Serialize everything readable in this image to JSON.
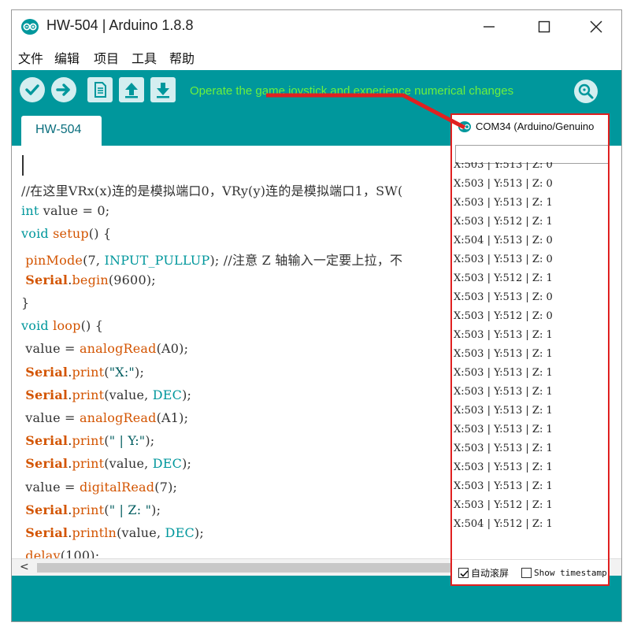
{
  "window": {
    "title": "HW-504 | Arduino 1.8.8"
  },
  "menu": {
    "items": [
      "文件",
      "编辑",
      "项目",
      "工具",
      "帮助"
    ]
  },
  "toolbar": {
    "annotation": "Operate the game joystick and experience numerical changes",
    "buttons": [
      "verify-icon",
      "upload-icon",
      "new-icon",
      "open-icon",
      "save-icon"
    ],
    "monitor_icon": "serial-monitor-icon"
  },
  "tabs": [
    {
      "label": "HW-504"
    }
  ],
  "editor": {
    "lines": [
      "//在这里VRx(x)连的是模拟端口0，VRy(y)连的是模拟端口1，SW(",
      "int value = 0;",
      "void setup() {",
      " pinMode(7, INPUT_PULLUP); //注意 Z 轴输入一定要上拉，不",
      " Serial.begin(9600);",
      "}",
      "void loop() {",
      " value = analogRead(A0);",
      " Serial.print(\"X:\");",
      " Serial.print(value, DEC);",
      " value = analogRead(A1);",
      " Serial.print(\" | Y:\");",
      " Serial.print(value, DEC);",
      " value = digitalRead(7);",
      " Serial.print(\" | Z: \");",
      " Serial.println(value, DEC);",
      " delay(100);"
    ]
  },
  "serial_monitor": {
    "title": "COM34 (Arduino/Genuino",
    "input_value": "",
    "lines": [
      "X:503 | Y:513 | Z: 0",
      "X:503 | Y:513 | Z: 0",
      "X:503 | Y:513 | Z: 1",
      "X:503 | Y:512 | Z: 1",
      "X:504 | Y:513 | Z: 0",
      "X:503 | Y:513 | Z: 0",
      "X:503 | Y:512 | Z: 1",
      "X:503 | Y:513 | Z: 0",
      "X:503 | Y:512 | Z: 0",
      "X:503 | Y:513 | Z: 1",
      "X:503 | Y:513 | Z: 1",
      "X:503 | Y:513 | Z: 1",
      "X:503 | Y:513 | Z: 1",
      "X:503 | Y:513 | Z: 1",
      "X:503 | Y:513 | Z: 1",
      "X:503 | Y:513 | Z: 1",
      "X:503 | Y:513 | Z: 1",
      "X:503 | Y:513 | Z: 1",
      "X:503 | Y:512 | Z: 1",
      "X:504 | Y:512 | Z: 1"
    ],
    "autoscroll_label": "自动滚屏",
    "autoscroll_checked": true,
    "timestamp_label": "Show timestamp",
    "timestamp_checked": false
  },
  "colors": {
    "accent": "#00979c",
    "annotation_text": "#6df03e",
    "annotation_arrow": "#e02020"
  }
}
